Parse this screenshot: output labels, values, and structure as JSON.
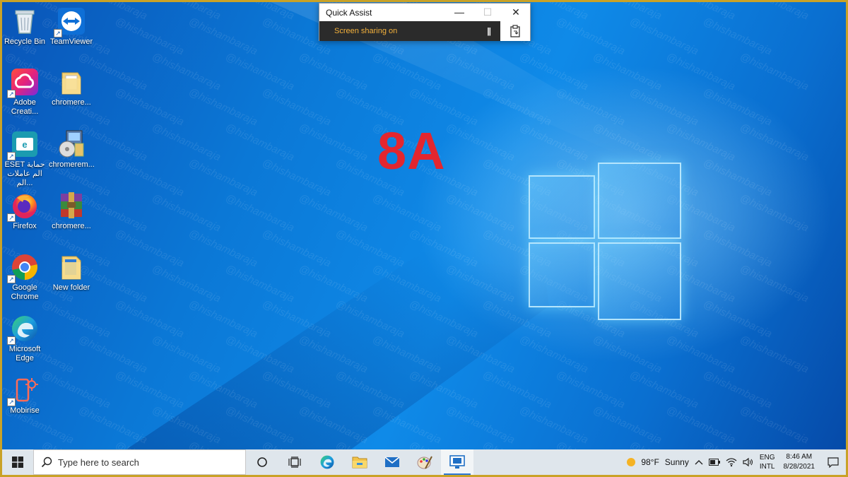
{
  "desktop": {
    "overlay_text": "8A",
    "watermark": "@hishambaraja",
    "icons": [
      {
        "label": "Recycle Bin",
        "icon": "recycle-bin-icon"
      },
      {
        "label": "TeamViewer",
        "icon": "teamviewer-icon"
      },
      {
        "label": "Adobe Creati...",
        "icon": "adobe-creative-cloud-icon"
      },
      {
        "label": "chromere...",
        "icon": "folder-icon"
      },
      {
        "label": "ESET حماية الم عاملات الم...",
        "icon": "eset-icon"
      },
      {
        "label": "chromerem...",
        "icon": "installer-icon"
      },
      {
        "label": "Firefox",
        "icon": "firefox-icon"
      },
      {
        "label": "chromere...",
        "icon": "winrar-archive-icon"
      },
      {
        "label": "Google Chrome",
        "icon": "chrome-icon"
      },
      {
        "label": "New folder",
        "icon": "folder-icon"
      },
      {
        "label": "Microsoft Edge",
        "icon": "edge-icon"
      },
      {
        "label": "Mobirise",
        "icon": "mobirise-icon"
      }
    ]
  },
  "quick_assist": {
    "title": "Quick Assist",
    "minimize": "—",
    "maximize": "☐",
    "close": "✕",
    "status": "Screen sharing on",
    "pause": "||"
  },
  "taskbar": {
    "search_placeholder": "Type here to search",
    "apps": [
      "cortana-icon",
      "task-view-icon",
      "edge-icon",
      "file-explorer-icon",
      "mail-icon",
      "paint-icon",
      "quick-assist-icon"
    ],
    "weather_temp": "98°F",
    "weather_text": "Sunny",
    "lang_top": "ENG",
    "lang_bottom": "INTL",
    "time": "8:46 AM",
    "date": "8/28/2021"
  },
  "colors": {
    "overlay_text": "#e3262f",
    "share_text": "#f5b23c",
    "frame": "#c9a227"
  }
}
